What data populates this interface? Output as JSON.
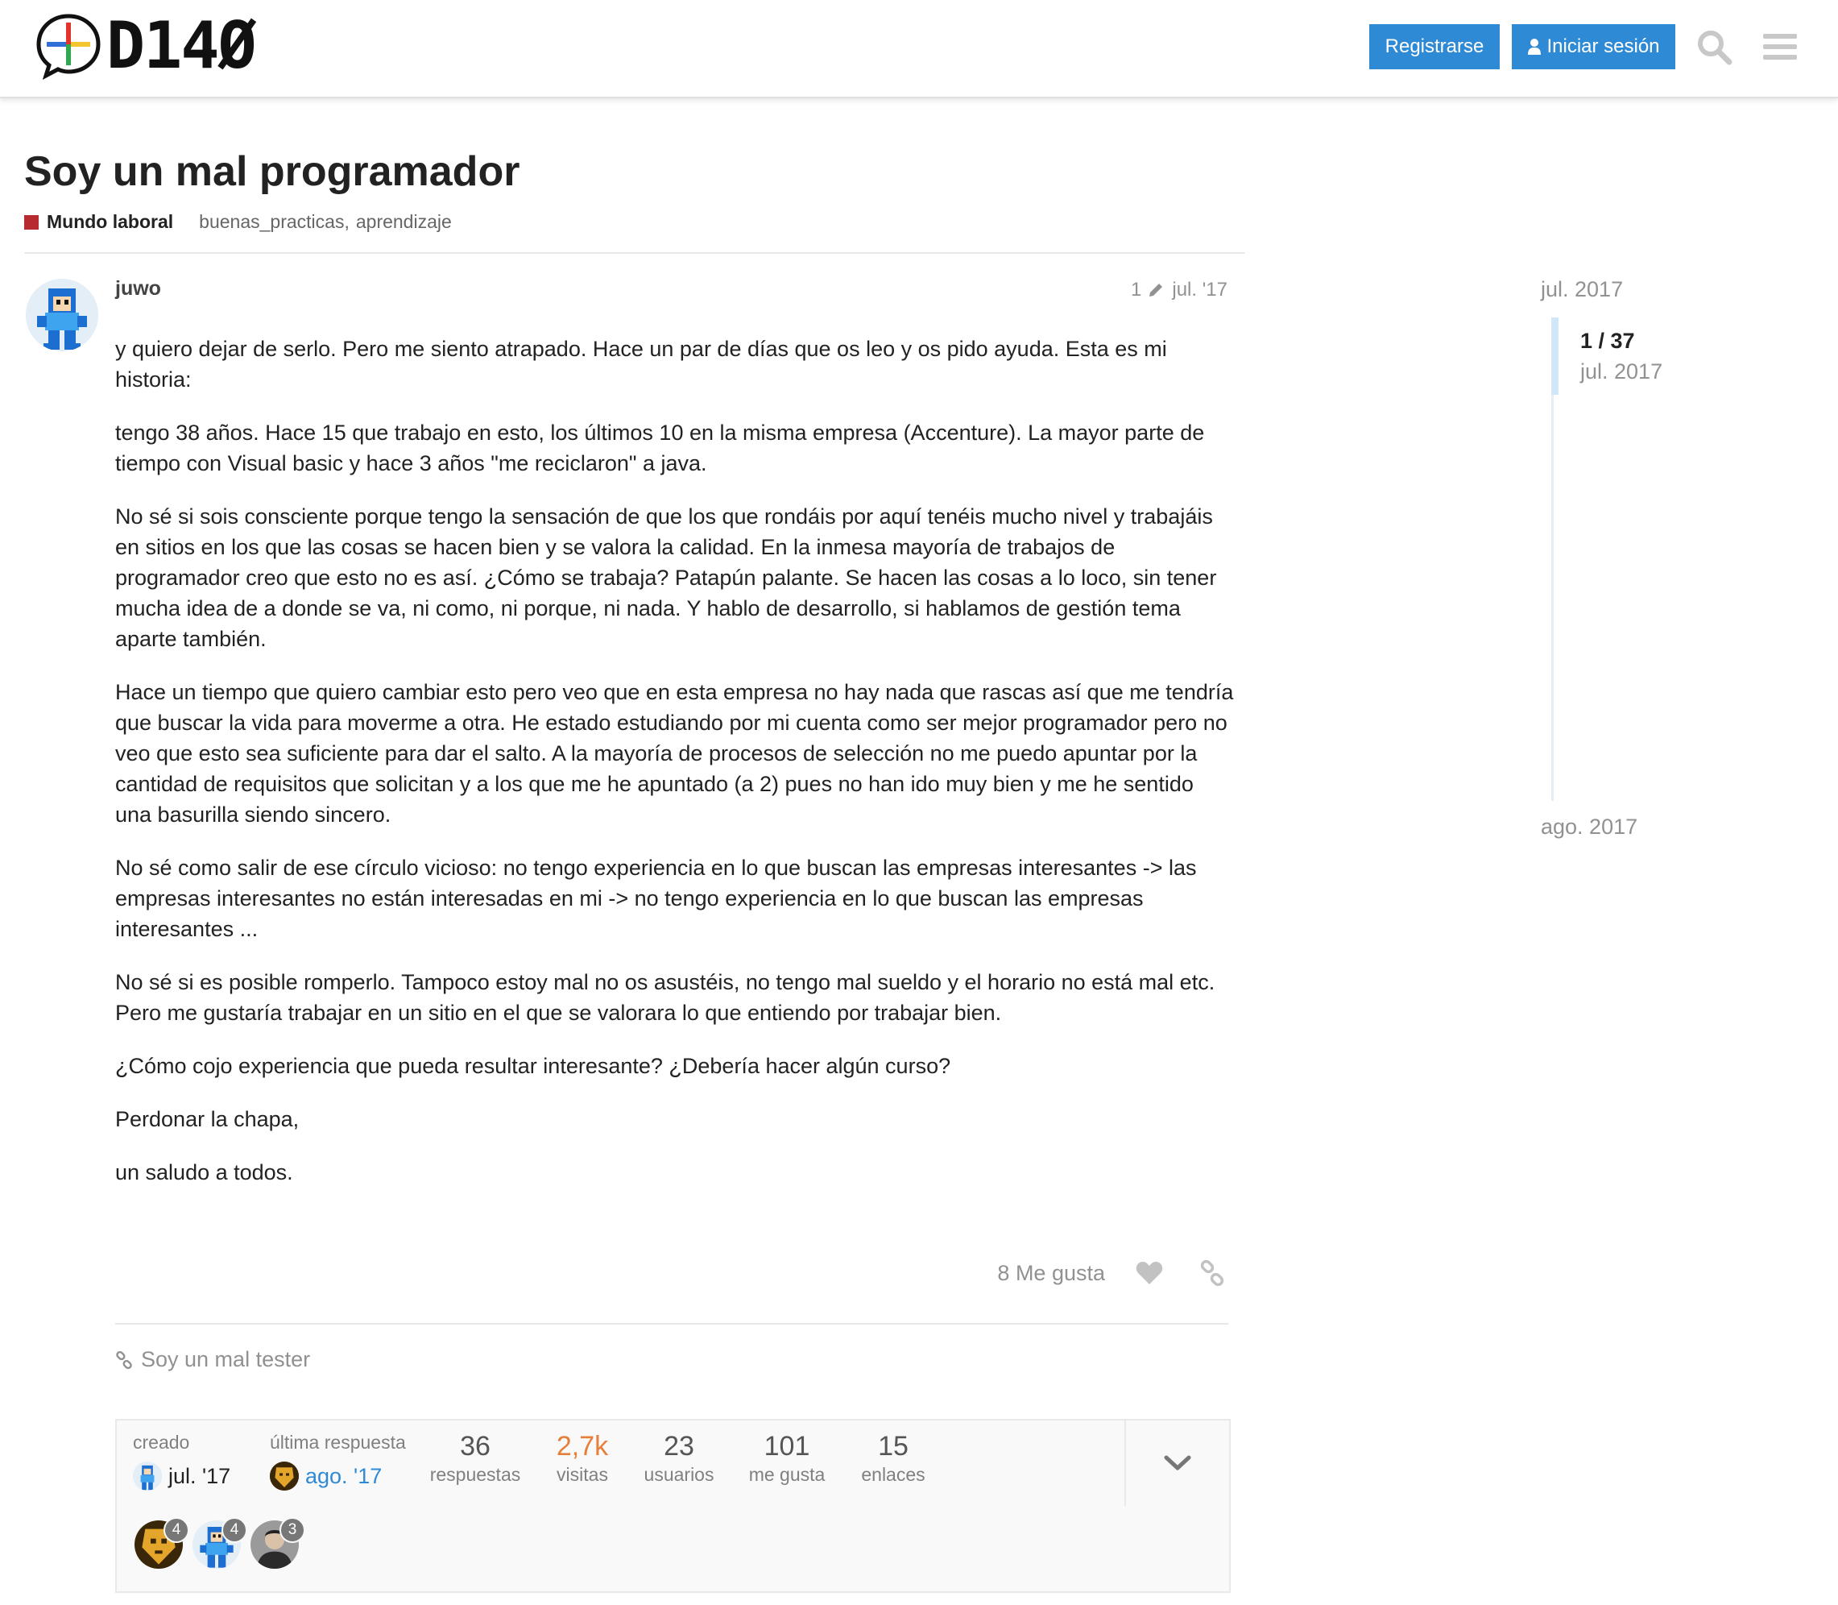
{
  "header": {
    "logo_text": "D14Ø",
    "register_label": "Registrarse",
    "login_label": "Iniciar sesión",
    "icons": [
      "logo-plus-bubble-icon",
      "user-icon",
      "search-icon",
      "hamburger-menu-icon"
    ],
    "accent_color": "#2f8ad6"
  },
  "topic": {
    "title": "Soy un mal programador",
    "category": "Mundo laboral",
    "category_color": "#b72a30",
    "tags": [
      "buenas_practicas",
      "aprendizaje"
    ],
    "tag_separator": ","
  },
  "post": {
    "username": "juwo",
    "edit_count": "1",
    "date": "jul. '17",
    "paragraphs": [
      "y quiero dejar de serlo. Pero me siento atrapado. Hace un par de días que os leo y os pido ayuda. Esta es mi historia:",
      "tengo 38 años. Hace 15 que trabajo en esto, los últimos 10 en la misma empresa (Accenture). La mayor parte de tiempo con Visual basic y hace 3 años \"me reciclaron\" a java.",
      "No sé si sois consciente porque tengo la sensación de que los que rondáis por aquí tenéis mucho nivel y trabajáis en sitios en los que las cosas se hacen bien y se valora la calidad. En la inmesa mayoría de trabajos de programador creo que esto no es así. ¿Cómo se trabaja? Patapún palante. Se hacen las cosas a lo loco, sin tener mucha idea de a donde se va, ni como, ni porque, ni nada. Y hablo de desarrollo, si hablamos de gestión tema aparte también.",
      "Hace un tiempo que quiero cambiar esto pero veo que en esta empresa no hay nada que rascas así que me tendría que buscar la vida para moverme a otra. He estado estudiando por mi cuenta como ser mejor programador pero no veo que esto sea suficiente para dar el salto. A la mayoría de procesos de selección no me puedo apuntar por la cantidad de requisitos que solicitan y a los que me he apuntado (a 2) pues no han ido muy bien y me he sentido una basurilla siendo sincero.",
      "No sé como salir de ese círculo vicioso: no tengo experiencia en lo que buscan las empresas interesantes -> las empresas interesantes no están interesadas en mi -> no tengo experiencia en lo que buscan las empresas interesantes ...",
      "No sé si es posible romperlo. Tampoco estoy mal no os asustéis, no tengo mal sueldo y el horario no está mal etc. Pero me gustaría trabajar en un sitio en el que se valorara lo que entiendo por trabajar bien.",
      "¿Cómo cojo experiencia que pueda resultar interesante? ¿Debería hacer algún curso?",
      "Perdonar la chapa,",
      "un saludo a todos."
    ],
    "likes_label": "8 Me gusta",
    "actions": [
      "heart-icon",
      "link-icon"
    ],
    "linked_topic": "Soy un mal tester"
  },
  "topic_map": {
    "created_label": "creado",
    "created_date": "jul. '17",
    "last_reply_label": "última respuesta",
    "last_reply_date": "ago. '17",
    "stats": [
      {
        "num": "36",
        "label": "respuestas"
      },
      {
        "num": "2,7k",
        "label": "visitas"
      },
      {
        "num": "23",
        "label": "usuarios"
      },
      {
        "num": "101",
        "label": "me gusta"
      },
      {
        "num": "15",
        "label": "enlaces"
      }
    ],
    "hot_stat_color": "#e57f3a",
    "participants": [
      {
        "count": "4"
      },
      {
        "count": "4"
      },
      {
        "count": "3"
      }
    ]
  },
  "timeline": {
    "start": "jul. 2017",
    "position": "1 / 37",
    "position_date": "jul. 2017",
    "end": "ago. 2017"
  }
}
